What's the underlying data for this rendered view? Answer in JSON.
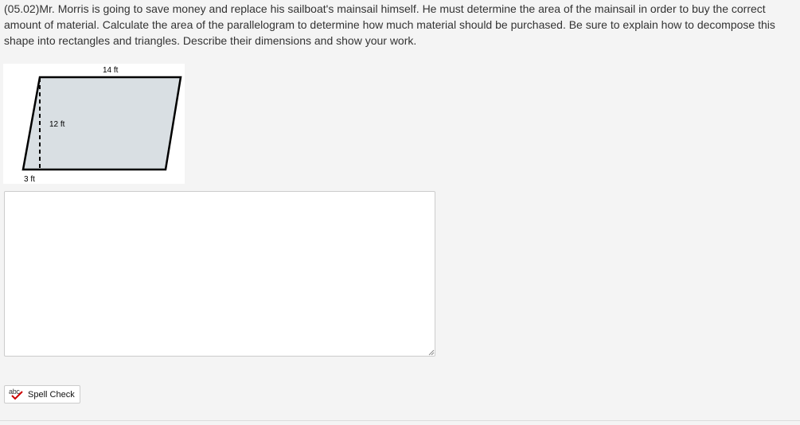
{
  "question": {
    "text": "(05.02)Mr. Morris is going to save money and replace his sailboat's mainsail himself. He must determine the area of the mainsail in order to buy the correct amount of material. Calculate the area of the parallelogram to determine how much material should be purchased. Be sure to explain how to decompose this shape into rectangles and triangles. Describe their dimensions and show your work."
  },
  "figure": {
    "top_label": "14 ft",
    "height_label": "12 ft",
    "offset_label": "3 ft",
    "fill_color": "#d9dfe3",
    "stroke_color": "#000000"
  },
  "answer": {
    "value": "",
    "placeholder": ""
  },
  "spellcheck": {
    "icon_text": "abc",
    "label": "Spell Check",
    "icon": "spellcheck-icon",
    "check_color": "#cc0000"
  }
}
